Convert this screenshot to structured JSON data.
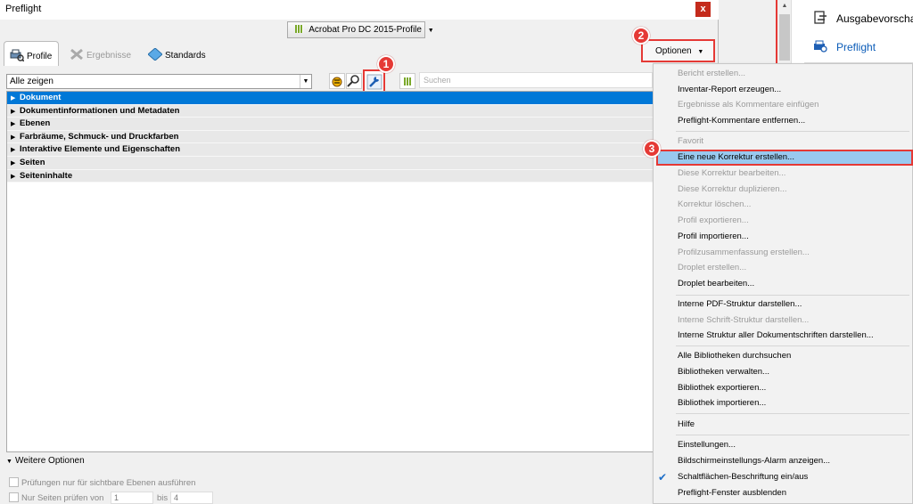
{
  "window": {
    "title": "Preflight",
    "close_glyph": "x"
  },
  "profile_dropdown": {
    "label": "Acrobat Pro DC 2015-Profile"
  },
  "tabs": [
    {
      "label": "Profile"
    },
    {
      "label": "Ergebnisse"
    },
    {
      "label": "Standards"
    }
  ],
  "options_button": {
    "label": "Optionen"
  },
  "callouts": [
    "1",
    "2",
    "3"
  ],
  "toolbar": {
    "show_select": "Alle zeigen",
    "search_placeholder": "Suchen"
  },
  "tree_rows": [
    {
      "label": "Dokument",
      "selected": true
    },
    {
      "label": "Dokumentinformationen und Metadaten"
    },
    {
      "label": "Ebenen"
    },
    {
      "label": "Farbräume, Schmuck- und Druckfarben"
    },
    {
      "label": "Interaktive Elemente und Eigenschaften"
    },
    {
      "label": "Seiten"
    },
    {
      "label": "Seiteninhalte"
    }
  ],
  "bottom": {
    "more_options": "Weitere Optionen",
    "visible_layers": "Prüfungen nur für sichtbare Ebenen ausführen",
    "pages_check": "Nur Seiten prüfen von",
    "page_from": "1",
    "page_to_label": "bis",
    "page_to": "4"
  },
  "right_pane": {
    "items": [
      {
        "label": "Ausgabevorschau"
      },
      {
        "label": "Preflight"
      }
    ]
  },
  "menu": {
    "items": [
      {
        "label": "Bericht erstellen...",
        "disabled": true
      },
      {
        "label": "Inventar-Report erzeugen...",
        "disabled": false
      },
      {
        "label": "Ergebnisse als Kommentare einfügen",
        "disabled": true
      },
      {
        "label": "Preflight-Kommentare entfernen...",
        "disabled": false
      },
      {
        "label": "Favorit",
        "disabled": true
      },
      {
        "label": "Eine neue Korrektur erstellen...",
        "disabled": false,
        "highlighted": true
      },
      {
        "label": "Diese Korrektur bearbeiten...",
        "disabled": true
      },
      {
        "label": "Diese Korrektur duplizieren...",
        "disabled": true
      },
      {
        "label": "Korrektur löschen...",
        "disabled": true
      },
      {
        "label": "Profil exportieren...",
        "disabled": true
      },
      {
        "label": "Profil importieren...",
        "disabled": false
      },
      {
        "label": "Profilzusammenfassung erstellen...",
        "disabled": true
      },
      {
        "label": "Droplet erstellen...",
        "disabled": true
      },
      {
        "label": "Droplet bearbeiten...",
        "disabled": false
      },
      {
        "label": "Interne PDF-Struktur darstellen...",
        "disabled": false
      },
      {
        "label": "Interne Schrift-Struktur darstellen...",
        "disabled": true
      },
      {
        "label": "Interne Struktur aller Dokumentschriften darstellen...",
        "disabled": false
      },
      {
        "label": "Alle Bibliotheken durchsuchen",
        "disabled": false
      },
      {
        "label": "Bibliotheken verwalten...",
        "disabled": false
      },
      {
        "label": "Bibliothek exportieren...",
        "disabled": false
      },
      {
        "label": "Bibliothek importieren...",
        "disabled": false
      },
      {
        "label": "Hilfe",
        "disabled": false
      },
      {
        "label": "Einstellungen...",
        "disabled": false
      },
      {
        "label": "Bildschirmeinstellungs-Alarm anzeigen...",
        "disabled": false
      },
      {
        "label": "Schaltflächen-Beschriftung ein/aus",
        "disabled": false,
        "checked": true
      },
      {
        "label": "Preflight-Fenster ausblenden",
        "disabled": false
      }
    ]
  },
  "colors": {
    "accent_red": "#e53935",
    "selection_blue": "#0078d7",
    "menu_highlight": "#99c9ef"
  }
}
